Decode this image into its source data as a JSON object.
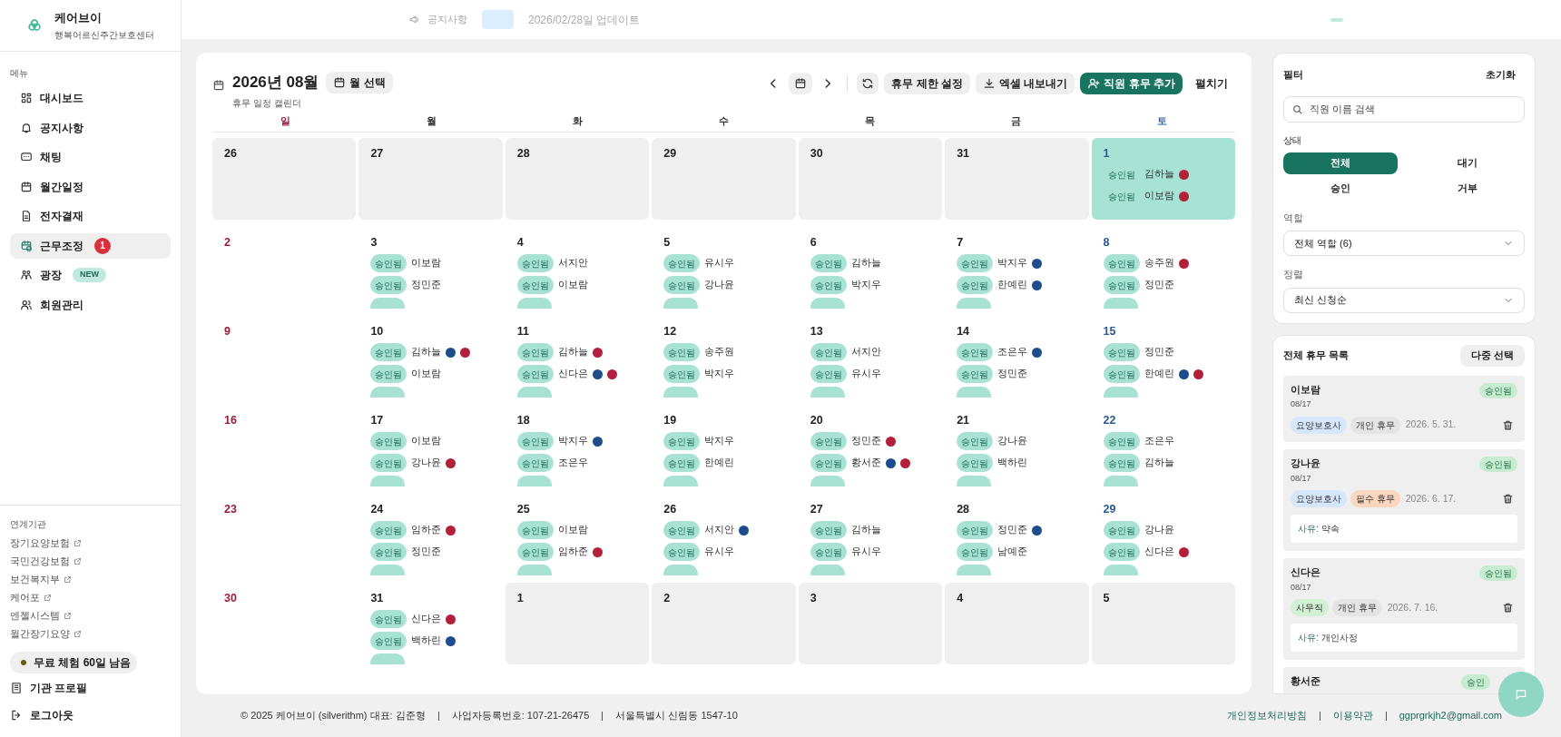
{
  "sidebar": {
    "brand": {
      "name": "케어브이",
      "subtitle": "행복어르신주간보호센터"
    },
    "menu_heading": "메뉴",
    "items": [
      {
        "label": "대시보드",
        "selected": false
      },
      {
        "label": "공지사항",
        "selected": false
      },
      {
        "label": "채팅",
        "selected": false
      },
      {
        "label": "월간일정",
        "selected": false
      },
      {
        "label": "전자결재",
        "selected": false
      },
      {
        "label": "근무조정",
        "selected": true,
        "badge": {
          "text": "1",
          "kind": "count"
        }
      },
      {
        "label": "광장",
        "selected": false,
        "badge": {
          "text": "NEW",
          "kind": "new"
        }
      },
      {
        "label": "회원관리",
        "selected": false
      }
    ],
    "links_heading": "연계기관",
    "links": [
      "장기요양보험",
      "국민건강보험",
      "보건복지부",
      "케어포",
      "엔젤시스템",
      "월간장기요양"
    ],
    "trial": "무료 체험 60일 남음",
    "bottom": [
      "기관 프로필",
      "로그아웃"
    ]
  },
  "top_bar": {
    "notice": "공지사항",
    "update": "2026/02/28일 업데이트"
  },
  "calendar": {
    "title": "2026년 08월",
    "subtitle": "휴무 일정 캘린더",
    "month_button": "월 선택",
    "toolbar": [
      {
        "label": "휴무 제한 설정",
        "kind": "plain"
      },
      {
        "label": "엑셀 내보내기",
        "kind": "export"
      },
      {
        "label": "직원 휴무 추가",
        "kind": "primary"
      },
      {
        "label": "펼치기",
        "kind": "text"
      }
    ],
    "weekdays": [
      "일",
      "월",
      "화",
      "수",
      "목",
      "금",
      "토"
    ],
    "weeks": [
      [
        {
          "day": "26",
          "outside": true,
          "selected": false
        },
        {
          "day": "27",
          "outside": true,
          "selected": false
        },
        {
          "day": "28",
          "outside": true,
          "selected": false
        },
        {
          "day": "29",
          "outside": true,
          "selected": false
        },
        {
          "day": "30",
          "outside": true,
          "selected": false
        },
        {
          "day": "31",
          "outside": true,
          "selected": false
        },
        {
          "day": "1",
          "outside": false,
          "selected": true,
          "entries": [
            {
              "status": "승인됨",
              "name": "김하늘",
              "marks": [
                {
                  "color": "#b3203b"
                }
              ]
            },
            {
              "status": "승인됨",
              "name": "이보람",
              "marks": [
                {
                  "color": "#b3203b"
                }
              ]
            }
          ]
        }
      ],
      [
        {
          "day": "2",
          "outside": false,
          "selected": false
        },
        {
          "day": "3",
          "outside": false,
          "selected": false,
          "more": true,
          "entries": [
            {
              "status": "승인됨",
              "name": "이보람"
            },
            {
              "status": "승인됨",
              "name": "정민준"
            }
          ]
        },
        {
          "day": "4",
          "outside": false,
          "selected": false,
          "more": true,
          "entries": [
            {
              "status": "승인됨",
              "name": "서지안"
            },
            {
              "status": "승인됨",
              "name": "이보람"
            }
          ]
        },
        {
          "day": "5",
          "outside": false,
          "selected": false,
          "more": true,
          "entries": [
            {
              "status": "승인됨",
              "name": "유시우"
            },
            {
              "status": "승인됨",
              "name": "강나윤"
            }
          ]
        },
        {
          "day": "6",
          "outside": false,
          "selected": false,
          "more": true,
          "entries": [
            {
              "status": "승인됨",
              "name": "김하늘"
            },
            {
              "status": "승인됨",
              "name": "박지우"
            }
          ]
        },
        {
          "day": "7",
          "outside": false,
          "selected": false,
          "more": true,
          "entries": [
            {
              "status": "승인됨",
              "name": "박지우",
              "marks": [
                {
                  "color": "#1e4d8c"
                }
              ]
            },
            {
              "status": "승인됨",
              "name": "한예린",
              "marks": [
                {
                  "color": "#1e4d8c"
                }
              ]
            }
          ]
        },
        {
          "day": "8",
          "outside": false,
          "selected": false,
          "more": true,
          "entries": [
            {
              "status": "승인됨",
              "name": "송주원",
              "marks": [
                {
                  "color": "#b3203b"
                }
              ]
            },
            {
              "status": "승인됨",
              "name": "정민준"
            }
          ]
        }
      ],
      [
        {
          "day": "9",
          "outside": false,
          "selected": false
        },
        {
          "day": "10",
          "outside": false,
          "selected": false,
          "more": true,
          "entries": [
            {
              "status": "승인됨",
              "name": "김하늘",
              "marks": [
                {
                  "color": "#1e4d8c"
                },
                {
                  "color": "#b3203b"
                }
              ]
            },
            {
              "status": "승인됨",
              "name": "이보람"
            }
          ]
        },
        {
          "day": "11",
          "outside": false,
          "selected": false,
          "more": true,
          "entries": [
            {
              "status": "승인됨",
              "name": "김하늘",
              "marks": [
                {
                  "color": "#b3203b"
                }
              ]
            },
            {
              "status": "승인됨",
              "name": "신다은",
              "marks": [
                {
                  "color": "#1e4d8c"
                },
                {
                  "color": "#b3203b"
                }
              ]
            }
          ]
        },
        {
          "day": "12",
          "outside": false,
          "selected": false,
          "more": true,
          "entries": [
            {
              "status": "승인됨",
              "name": "송주원"
            },
            {
              "status": "승인됨",
              "name": "박지우"
            }
          ]
        },
        {
          "day": "13",
          "outside": false,
          "selected": false,
          "more": true,
          "entries": [
            {
              "status": "승인됨",
              "name": "서지안"
            },
            {
              "status": "승인됨",
              "name": "유시우"
            }
          ]
        },
        {
          "day": "14",
          "outside": false,
          "selected": false,
          "more": true,
          "entries": [
            {
              "status": "승인됨",
              "name": "조은우",
              "marks": [
                {
                  "color": "#1e4d8c"
                }
              ]
            },
            {
              "status": "승인됨",
              "name": "정민준"
            }
          ]
        },
        {
          "day": "15",
          "outside": false,
          "selected": false,
          "more": true,
          "entries": [
            {
              "status": "승인됨",
              "name": "정민준"
            },
            {
              "status": "승인됨",
              "name": "한예린",
              "marks": [
                {
                  "color": "#1e4d8c"
                },
                {
                  "color": "#b3203b"
                }
              ]
            }
          ]
        }
      ],
      [
        {
          "day": "16",
          "outside": false,
          "selected": false
        },
        {
          "day": "17",
          "outside": false,
          "selected": false,
          "more": true,
          "entries": [
            {
              "status": "승인됨",
              "name": "이보람"
            },
            {
              "status": "승인됨",
              "name": "강나윤",
              "marks": [
                {
                  "color": "#b3203b"
                }
              ]
            }
          ]
        },
        {
          "day": "18",
          "outside": false,
          "selected": false,
          "more": true,
          "entries": [
            {
              "status": "승인됨",
              "name": "박지우",
              "marks": [
                {
                  "color": "#1e4d8c"
                }
              ]
            },
            {
              "status": "승인됨",
              "name": "조은우"
            }
          ]
        },
        {
          "day": "19",
          "outside": false,
          "selected": false,
          "more": true,
          "entries": [
            {
              "status": "승인됨",
              "name": "박지우"
            },
            {
              "status": "승인됨",
              "name": "한예린"
            }
          ]
        },
        {
          "day": "20",
          "outside": false,
          "selected": false,
          "more": true,
          "entries": [
            {
              "status": "승인됨",
              "name": "정민준",
              "marks": [
                {
                  "color": "#b3203b"
                }
              ]
            },
            {
              "status": "승인됨",
              "name": "황서준",
              "marks": [
                {
                  "color": "#1e4d8c"
                },
                {
                  "color": "#b3203b"
                }
              ]
            }
          ]
        },
        {
          "day": "21",
          "outside": false,
          "selected": false,
          "more": true,
          "entries": [
            {
              "status": "승인됨",
              "name": "강나윤"
            },
            {
              "status": "승인됨",
              "name": "백하린"
            }
          ]
        },
        {
          "day": "22",
          "outside": false,
          "selected": false,
          "more": true,
          "entries": [
            {
              "status": "승인됨",
              "name": "조은우"
            },
            {
              "status": "승인됨",
              "name": "김하늘"
            }
          ]
        }
      ],
      [
        {
          "day": "23",
          "outside": false,
          "selected": false
        },
        {
          "day": "24",
          "outside": false,
          "selected": false,
          "more": true,
          "entries": [
            {
              "status": "승인됨",
              "name": "임하준",
              "marks": [
                {
                  "color": "#b3203b"
                }
              ]
            },
            {
              "status": "승인됨",
              "name": "정민준"
            }
          ]
        },
        {
          "day": "25",
          "outside": false,
          "selected": false,
          "more": true,
          "entries": [
            {
              "status": "승인됨",
              "name": "이보람"
            },
            {
              "status": "승인됨",
              "name": "임하준",
              "marks": [
                {
                  "color": "#b3203b"
                }
              ]
            }
          ]
        },
        {
          "day": "26",
          "outside": false,
          "selected": false,
          "more": true,
          "entries": [
            {
              "status": "승인됨",
              "name": "서지안",
              "marks": [
                {
                  "color": "#1e4d8c"
                }
              ]
            },
            {
              "status": "승인됨",
              "name": "유시우"
            }
          ]
        },
        {
          "day": "27",
          "outside": false,
          "selected": false,
          "more": true,
          "entries": [
            {
              "status": "승인됨",
              "name": "김하늘"
            },
            {
              "status": "승인됨",
              "name": "유시우"
            }
          ]
        },
        {
          "day": "28",
          "outside": false,
          "selected": false,
          "more": true,
          "entries": [
            {
              "status": "승인됨",
              "name": "정민준",
              "marks": [
                {
                  "color": "#1e4d8c"
                }
              ]
            },
            {
              "status": "승인됨",
              "name": "남예준"
            }
          ]
        },
        {
          "day": "29",
          "outside": false,
          "selected": false,
          "more": true,
          "entries": [
            {
              "status": "승인됨",
              "name": "강나윤"
            },
            {
              "status": "승인됨",
              "name": "신다은",
              "marks": [
                {
                  "color": "#b3203b"
                }
              ]
            }
          ]
        }
      ],
      [
        {
          "day": "30",
          "outside": false,
          "selected": false
        },
        {
          "day": "31",
          "outside": false,
          "selected": false,
          "more": true,
          "entries": [
            {
              "status": "승인됨",
              "name": "신다은",
              "marks": [
                {
                  "color": "#b3203b"
                }
              ]
            },
            {
              "status": "승인됨",
              "name": "백하린",
              "marks": [
                {
                  "color": "#1e4d8c"
                }
              ]
            }
          ]
        },
        {
          "day": "1",
          "outside": true,
          "selected": false
        },
        {
          "day": "2",
          "outside": true,
          "selected": false
        },
        {
          "day": "3",
          "outside": true,
          "selected": false
        },
        {
          "day": "4",
          "outside": true,
          "selected": false
        },
        {
          "day": "5",
          "outside": true,
          "selected": false
        }
      ]
    ]
  },
  "filter": {
    "title": "필터",
    "reset": "초기화",
    "search": {
      "placeholder": "직원 이름 검색"
    },
    "status_label": "상태",
    "status_options": [
      {
        "label": "전체",
        "selected": true
      },
      {
        "label": "대기",
        "selected": false
      },
      {
        "label": "승인",
        "selected": false
      },
      {
        "label": "거부",
        "selected": false
      }
    ],
    "role_label": "역할",
    "role_value": "전체 역할 (6)",
    "sort_label": "정렬",
    "sort_value": "최신 신청순"
  },
  "leave_list": {
    "title": "전체 휴무 목록",
    "button": "다중 선택",
    "items": [
      {
        "name": "이보람",
        "date": "08/17",
        "status": "승인됨",
        "role": {
          "text": "요양보호사",
          "color": "#d6e6fb"
        },
        "type": {
          "text": "개인 휴무",
          "color": "#e4e4e4"
        },
        "applied": "2026. 5. 31."
      },
      {
        "name": "강나윤",
        "date": "08/17",
        "status": "승인됨",
        "role": {
          "text": "요양보호사",
          "color": "#d6e6fb"
        },
        "type": {
          "text": "필수 휴무",
          "color": "#fbd6bf"
        },
        "applied": "2026. 6. 17.",
        "reason_label": "사유:",
        "reason": "약속"
      },
      {
        "name": "신다은",
        "date": "08/17",
        "status": "승인됨",
        "role": {
          "text": "사무직",
          "color": "#d2f0d4"
        },
        "type": {
          "text": "개인 휴무",
          "color": "#e4e4e4"
        },
        "applied": "2026. 7. 16.",
        "reason_label": "사유:",
        "reason": "개인사정"
      },
      {
        "name": "황서준",
        "status": "승인"
      }
    ]
  },
  "footer": {
    "left": [
      "© 2025 케어브이 (silverithm) 대표: 김준형",
      "사업자등록번호: 107-21-26475",
      "서울특별시 신림동 1547-10"
    ],
    "right": [
      "개인정보처리방침",
      "이용약관",
      "ggprgrkjh2@gmail.com"
    ]
  }
}
